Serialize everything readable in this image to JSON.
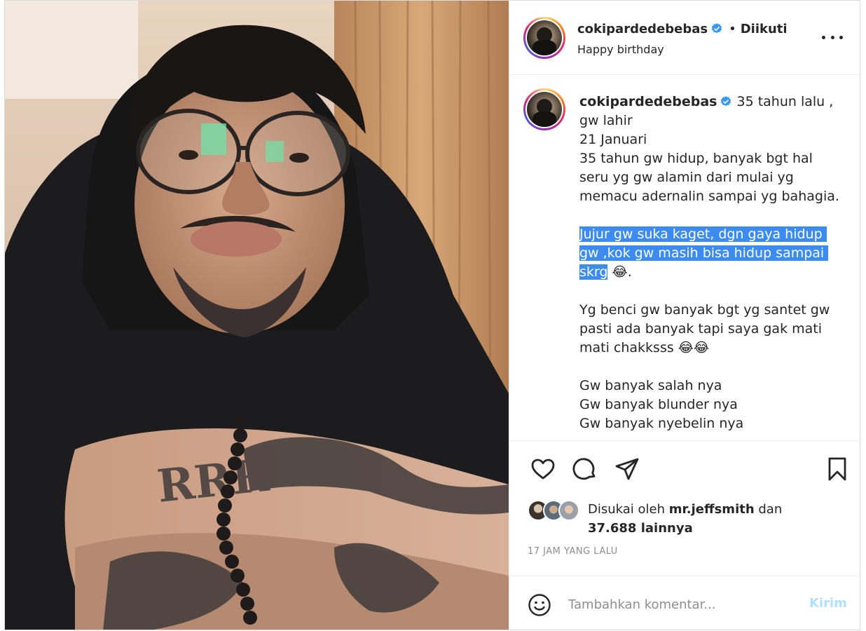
{
  "header": {
    "username": "cokipardedebebas",
    "separator": "•",
    "follow_status": "Diikuti",
    "subtitle": "Happy birthday",
    "more_icon": "more-horizontal-icon"
  },
  "caption": {
    "username": "cokipardedebebas",
    "line1": " 35 tahun lalu ,\ngw lahir\n21 Januari\n35 tahun gw hidup, banyak bgt hal seru yg gw alamin dari mulai yg memacu adernalin sampai yg bahagia.\n\n",
    "highlighted": "Jujur gw suka kaget, dgn gaya hidup gw ,kok gw masih bisa hidup sampai skrg",
    "after_highlight": " 😂.\n\nYg benci gw banyak bgt yg santet gw pasti ada banyak tapi saya gak mati mati chakksss 😂😂\n\nGw banyak salah nya\nGw banyak blunder nya\nGw banyak nyebelin nya"
  },
  "actions": {
    "like_icon": "heart-icon",
    "comment_icon": "comment-icon",
    "share_icon": "send-icon",
    "save_icon": "bookmark-icon"
  },
  "likes": {
    "prefix": "Disukai oleh ",
    "user": "mr.jeffsmith",
    "joiner": " dan",
    "count": "37.688 lainnya"
  },
  "timestamp": "17 JAM YANG LALU",
  "comment": {
    "placeholder": "Tambahkan komentar...",
    "post_label": "Kirim",
    "emoji_icon": "smiley-icon"
  },
  "colors": {
    "verified": "#3897f0",
    "highlight": "#3b8bf1",
    "post_disabled": "#b2dffc",
    "muted": "#8e8e8e"
  }
}
